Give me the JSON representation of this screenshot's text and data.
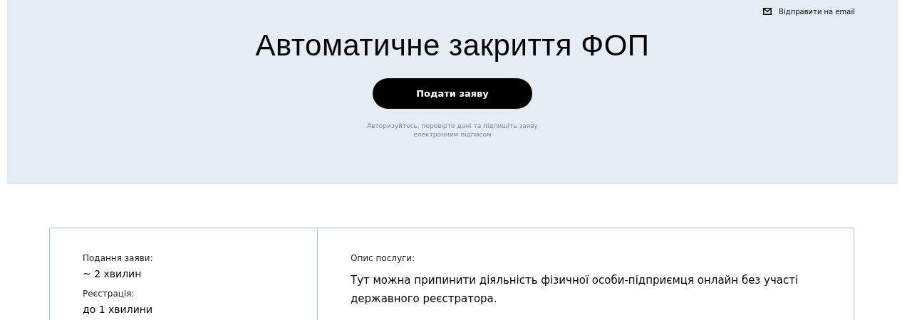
{
  "email_link": {
    "label": "Відправити на email"
  },
  "title": "Автоматичне закриття ФОП",
  "apply_button": {
    "label": "Подати заяву"
  },
  "hint": "Авторизуйтесь, перевірте дані та підпишіть заяву електронним підписом",
  "facts": [
    {
      "label": "Подання заяви:",
      "value": "~ 2 хвилин"
    },
    {
      "label": "Реєстрація:",
      "value": "до 1 хвилини"
    }
  ],
  "description": {
    "label": "Опис послуги:",
    "text": "Тут можна припинити діяльність фізичної особи-підприємця онлайн без участі державного реєстратора."
  }
}
